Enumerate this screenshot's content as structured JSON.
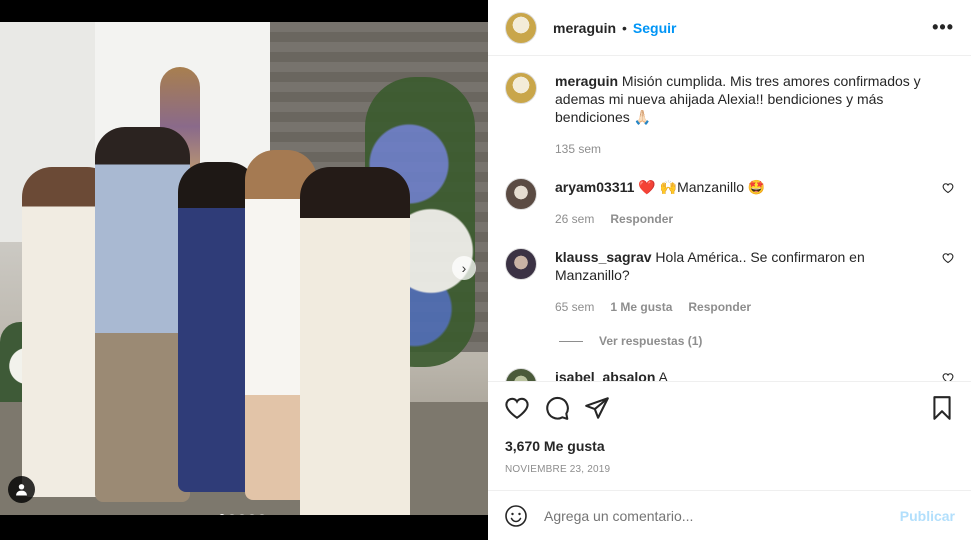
{
  "post": {
    "author": "meraguin",
    "follow_label": "Seguir",
    "more_label": "•••",
    "caption": "Misión cumplida. Mis tres amores confirmados y ademas mi nueva ahijada Alexia!! bendiciones y más bendiciones 🙏🏻",
    "caption_time": "135 sem"
  },
  "carousel": {
    "next_label": "›",
    "dots_count": 5,
    "active_dot": 0
  },
  "comments": [
    {
      "username": "aryam03311",
      "text": "❤️ 🙌Manzanillo 🤩",
      "time": "26 sem",
      "reply_label": "Responder"
    },
    {
      "username": "klauss_sagrav",
      "text": "Hola América.. Se confirmaron en Manzanillo?",
      "time": "65 sem",
      "likes_label": "1 Me gusta",
      "reply_label": "Responder",
      "view_replies": "Ver respuestas (1)"
    },
    {
      "username": "isabel_absalon",
      "text": "A"
    }
  ],
  "footer": {
    "likes": "3,670 Me gusta",
    "date": "NOVIEMBRE 23, 2019",
    "comment_placeholder": "Agrega un comentario...",
    "publish_label": "Publicar"
  },
  "icons": {
    "like": "heart-icon",
    "comment": "comment-icon",
    "share": "share-icon",
    "save": "bookmark-icon",
    "emoji": "emoji-icon",
    "tag": "user-tag-icon"
  },
  "colors": {
    "accent": "#0095f6",
    "publish_disabled": "#b2dffc",
    "secondary_text": "#8e8e8e",
    "primary_text": "#262626",
    "like_red": "#ed4956"
  }
}
